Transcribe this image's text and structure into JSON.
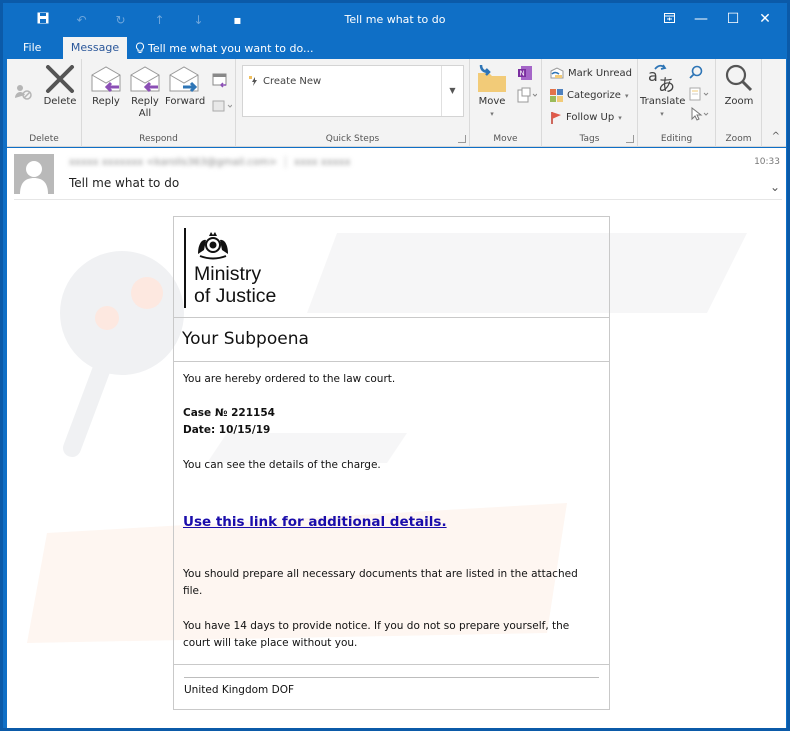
{
  "window": {
    "title": "Tell me what to do"
  },
  "quick_access": {
    "save_icon": "save-icon",
    "undo_icon": "undo-icon",
    "redo_icon": "redo-icon",
    "prev_icon": "up-arrow-icon",
    "next_icon": "down-arrow-icon",
    "customize_icon": "customize-icon"
  },
  "tabs": {
    "file": "File",
    "message": "Message",
    "tell_me": "Tell me what you want to do..."
  },
  "ribbon": {
    "groups": {
      "delete": "Delete",
      "respond": "Respond",
      "quick_steps": "Quick Steps",
      "move": "Move",
      "tags": "Tags",
      "editing": "Editing",
      "zoom": "Zoom"
    },
    "buttons": {
      "delete": "Delete",
      "reply": "Reply",
      "reply_all_line1": "Reply",
      "reply_all_line2": "All",
      "forward": "Forward",
      "create_new": "Create New",
      "move": "Move",
      "mark_unread": "Mark Unread",
      "categorize": "Categorize",
      "follow_up": "Follow Up",
      "translate": "Translate",
      "zoom": "Zoom"
    }
  },
  "message": {
    "sender_redacted": "xxxxx xxxxxxx <karolis363@gmail.com>",
    "recipient_redacted": "xxxx xxxxx",
    "subject": "Tell me what to do",
    "time": "10:33",
    "body": {
      "logo_line1": "Ministry",
      "logo_line2": "of Justice",
      "heading": "Your Subpoena",
      "p1": "You are hereby ordered to the law court.",
      "case": "Case № 221154",
      "date": "Date: 10/15/19",
      "p2": "You can see the details of the charge.",
      "link": "Use this link for additional details.",
      "p3": "You should prepare all necessary documents that are listed in the attached file.",
      "p4": "You have 14 days to provide notice. If you do not so prepare yourself, the court will take place without you.",
      "footer": "United Kingdom DOF"
    }
  },
  "colors": {
    "accent": "#0f6fc6",
    "link": "#1a0dab",
    "reply_arrow": "#8b4fb5",
    "forward_arrow": "#2e75b6"
  }
}
